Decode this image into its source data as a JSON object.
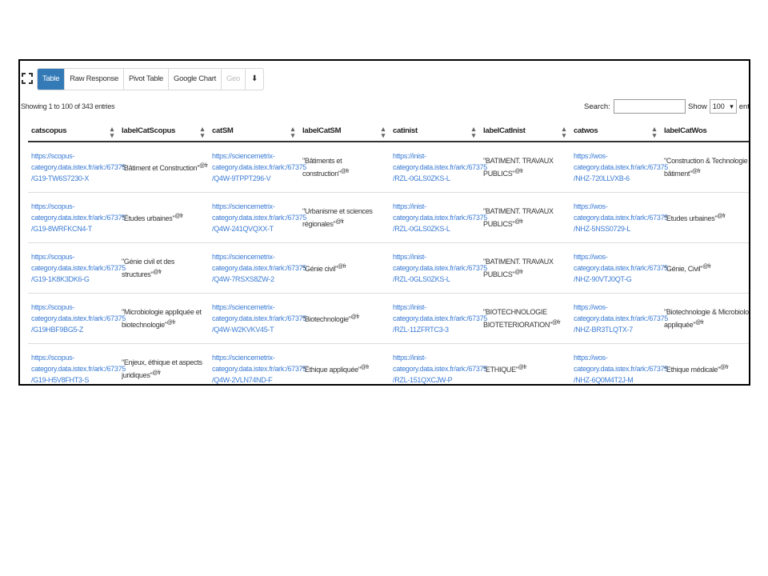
{
  "toolbar": {
    "tabs": [
      {
        "label": "Table",
        "active": true
      },
      {
        "label": "Raw Response",
        "active": false
      },
      {
        "label": "Pivot Table",
        "active": false
      },
      {
        "label": "Google Chart",
        "active": false
      },
      {
        "label": "Geo",
        "active": false,
        "disabled": true
      }
    ],
    "download_icon": "download-icon"
  },
  "info": "Showing 1 to 100 of 343 entries",
  "search": {
    "label": "Search:",
    "value": ""
  },
  "show": {
    "label": "Show",
    "value": "100",
    "suffix": "entri"
  },
  "columns": [
    "catscopus",
    "labelCatScopus",
    "catSM",
    "labelCatSM",
    "catinist",
    "labelCatInist",
    "catwos",
    "labelCatWos"
  ],
  "rows": [
    {
      "catscopus": [
        "https://scopus-",
        "category.data.istex.fr/ark:/67375",
        "/G19-TW6S7230-X"
      ],
      "labelCatScopus": "\"Bâtiment et Construction\"",
      "catSM": [
        "https://sciencemetrix-",
        "category.data.istex.fr/ark:/67375",
        "/Q4W-9TPPT296-V"
      ],
      "labelCatSM": "\"Bâtiments et construction\"",
      "catinist": [
        "https://inist-",
        "category.data.istex.fr/ark:/67375",
        "/RZL-0GLS0ZKS-L"
      ],
      "labelCatInist": "\"BATIMENT. TRAVAUX PUBLICS\"",
      "catwos": [
        "https://wos-",
        "category.data.istex.fr/ark:/67375",
        "/NHZ-720LLVXB-6"
      ],
      "labelCatWos": "\"Construction & Technologie du bâtiment\""
    },
    {
      "catscopus": [
        "https://scopus-",
        "category.data.istex.fr/ark:/67375",
        "/G19-8WRFKCN4-T"
      ],
      "labelCatScopus": "\"Études urbaines\"",
      "catSM": [
        "https://sciencemetrix-",
        "category.data.istex.fr/ark:/67375",
        "/Q4W-241QVQXX-T"
      ],
      "labelCatSM": "\"Urbanisme et sciences régionales\"",
      "catinist": [
        "https://inist-",
        "category.data.istex.fr/ark:/67375",
        "/RZL-0GLS0ZKS-L"
      ],
      "labelCatInist": "\"BATIMENT. TRAVAUX PUBLICS\"",
      "catwos": [
        "https://wos-",
        "category.data.istex.fr/ark:/67375",
        "/NHZ-5NSS0729-L"
      ],
      "labelCatWos": "\"Etudes urbaines\""
    },
    {
      "catscopus": [
        "https://scopus-",
        "category.data.istex.fr/ark:/67375",
        "/G19-1K8K3DK6-G"
      ],
      "labelCatScopus": "\"Génie civil et des structures\"",
      "catSM": [
        "https://sciencemetrix-",
        "category.data.istex.fr/ark:/67375",
        "/Q4W-7RSXS8ZW-2"
      ],
      "labelCatSM": "\"Génie civil\"",
      "catinist": [
        "https://inist-",
        "category.data.istex.fr/ark:/67375",
        "/RZL-0GLS0ZKS-L"
      ],
      "labelCatInist": "\"BATIMENT. TRAVAUX PUBLICS\"",
      "catwos": [
        "https://wos-",
        "category.data.istex.fr/ark:/67375",
        "/NHZ-90VTJ0QT-G"
      ],
      "labelCatWos": "\"Génie, Civil\""
    },
    {
      "catscopus": [
        "https://scopus-",
        "category.data.istex.fr/ark:/67375",
        "/G19HBF9BG5-Z"
      ],
      "labelCatScopus": "\"Microbiologie appliquée et biotechnologie\"",
      "catSM": [
        "https://sciencemetrix-",
        "category.data.istex.fr/ark:/67375",
        "/Q4W-W2KVKV45-T"
      ],
      "labelCatSM": "\"Biotechnologie\"",
      "catinist": [
        "https://inist-",
        "category.data.istex.fr/ark:/67375",
        "/RZL-11ZFRTC3-3"
      ],
      "labelCatInist": "\"BIOTECHNOLOGIE BIOTETERIORATION\"",
      "catwos": [
        "https://wos-",
        "category.data.istex.fr/ark:/67375",
        "/NHZ-BR3TLQTX-7"
      ],
      "labelCatWos": "\"Biotechnologie & Microbiologie appliquée\""
    },
    {
      "catscopus": [
        "https://scopus-",
        "category.data.istex.fr/ark:/67375",
        "/G19-H5V8FHT3-S"
      ],
      "labelCatScopus": "\"Enjeux, éthique et aspects juridiques\"",
      "catSM": [
        "https://sciencemetrix-",
        "category.data.istex.fr/ark:/67375",
        "/Q4W-2VLN74ND-F"
      ],
      "labelCatSM": "\"Éthique appliquée\"",
      "catinist": [
        "https://inist-",
        "category.data.istex.fr/ark:/67375",
        "/RZL-151QXCJW-P"
      ],
      "labelCatInist": "\"ETHIQUE\"",
      "catwos": [
        "https://wos-",
        "category.data.istex.fr/ark:/67375",
        "/NHZ-6Q0M4T2J-M"
      ],
      "labelCatWos": "\"Ethique médicale\""
    }
  ],
  "lang_suffix": "@fr",
  "colors": {
    "active_tab": "#337ab7",
    "link": "#3a7bd5"
  }
}
